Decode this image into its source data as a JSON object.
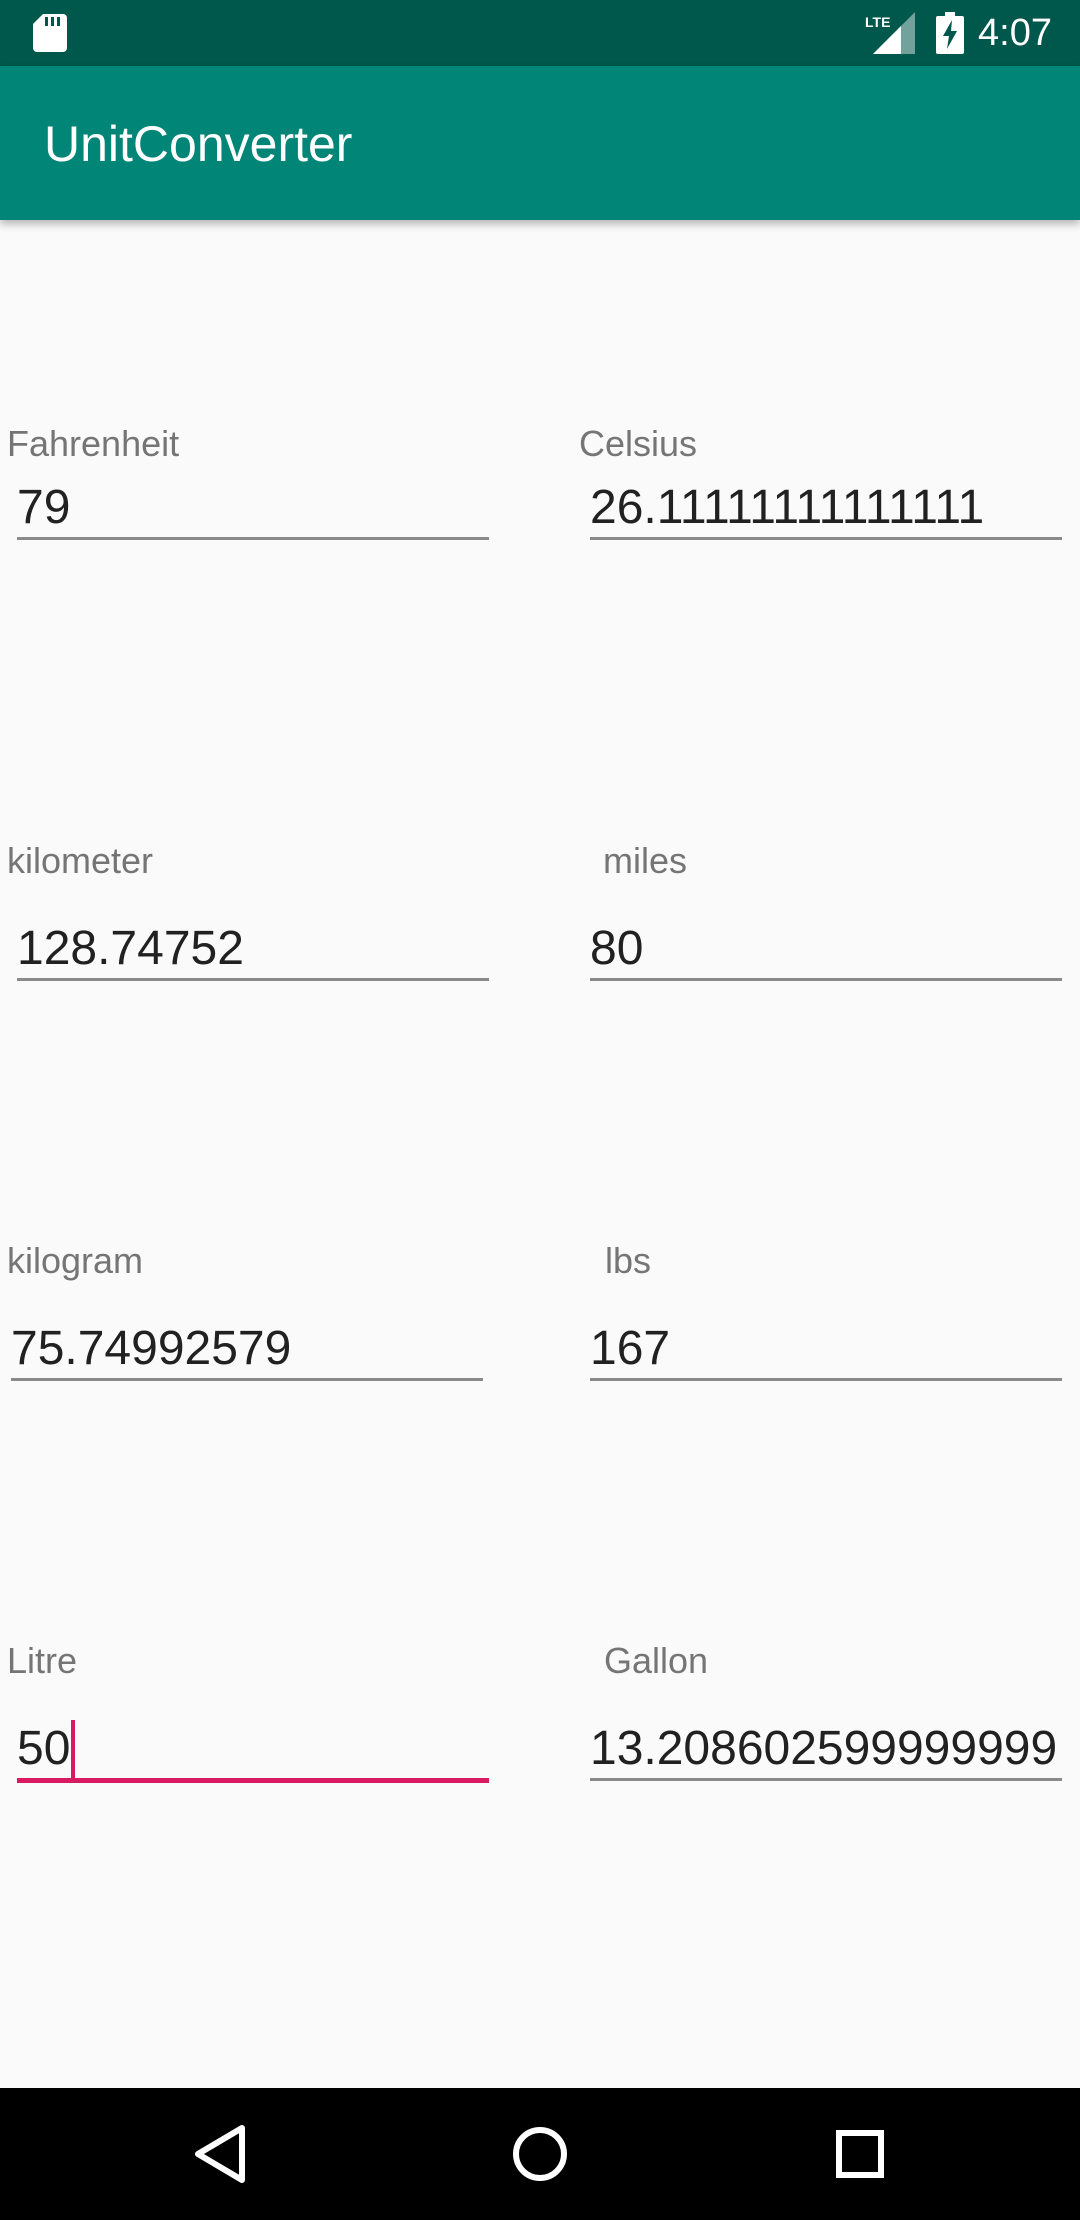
{
  "status_bar": {
    "time": "4:07",
    "network": "LTE"
  },
  "app_bar": {
    "title": "UnitConverter"
  },
  "rows": [
    {
      "left": {
        "label": "Fahrenheit",
        "value": "79"
      },
      "right": {
        "label": "Celsius",
        "value": "26.11111111111111"
      }
    },
    {
      "left": {
        "label": "kilometer",
        "value": "128.74752"
      },
      "right": {
        "label": "miles",
        "value": "80"
      }
    },
    {
      "left": {
        "label": "kilogram",
        "value": "75.74992579"
      },
      "right": {
        "label": "lbs",
        "value": "167"
      }
    },
    {
      "left": {
        "label": "Litre",
        "value": "50"
      },
      "right": {
        "label": "Gallon",
        "value": "13.208602599999999"
      }
    }
  ],
  "nav_bar": {
    "buttons": [
      "back-icon",
      "home-icon",
      "recents-icon"
    ]
  },
  "colors": {
    "app_bar": "#008577",
    "status_bar": "#00574b",
    "accent": "#d81b60"
  }
}
